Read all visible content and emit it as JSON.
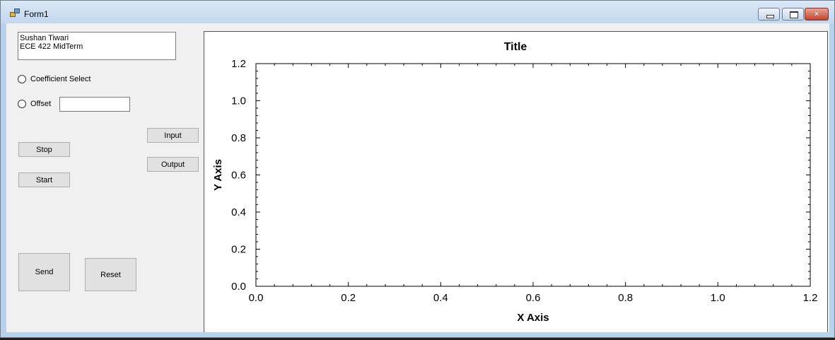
{
  "window": {
    "title": "Form1",
    "controls": {
      "minimize": "minimize",
      "maximize": "maximize",
      "close": "×"
    }
  },
  "textbox": {
    "lines": [
      "Sushan Tiwari",
      "ECE 422 MidTerm"
    ]
  },
  "radios": {
    "coefficient_label": "Coefficient Select",
    "offset_label": "Offset"
  },
  "offset_input": {
    "value": ""
  },
  "buttons": {
    "input": "Input",
    "output": "Output",
    "stop": "Stop",
    "start": "Start",
    "send": "Send",
    "reset": "Reset"
  },
  "chart_data": {
    "type": "line",
    "title": "Title",
    "xlabel": "X Axis",
    "ylabel": "Y Axis",
    "xlim": [
      0.0,
      1.2
    ],
    "ylim": [
      0.0,
      1.2
    ],
    "xticks": [
      "0.0",
      "0.2",
      "0.4",
      "0.6",
      "0.8",
      "1.0",
      "1.2"
    ],
    "yticks": [
      "0.0",
      "0.2",
      "0.4",
      "0.6",
      "0.8",
      "1.0",
      "1.2"
    ],
    "series": [],
    "grid": false
  }
}
